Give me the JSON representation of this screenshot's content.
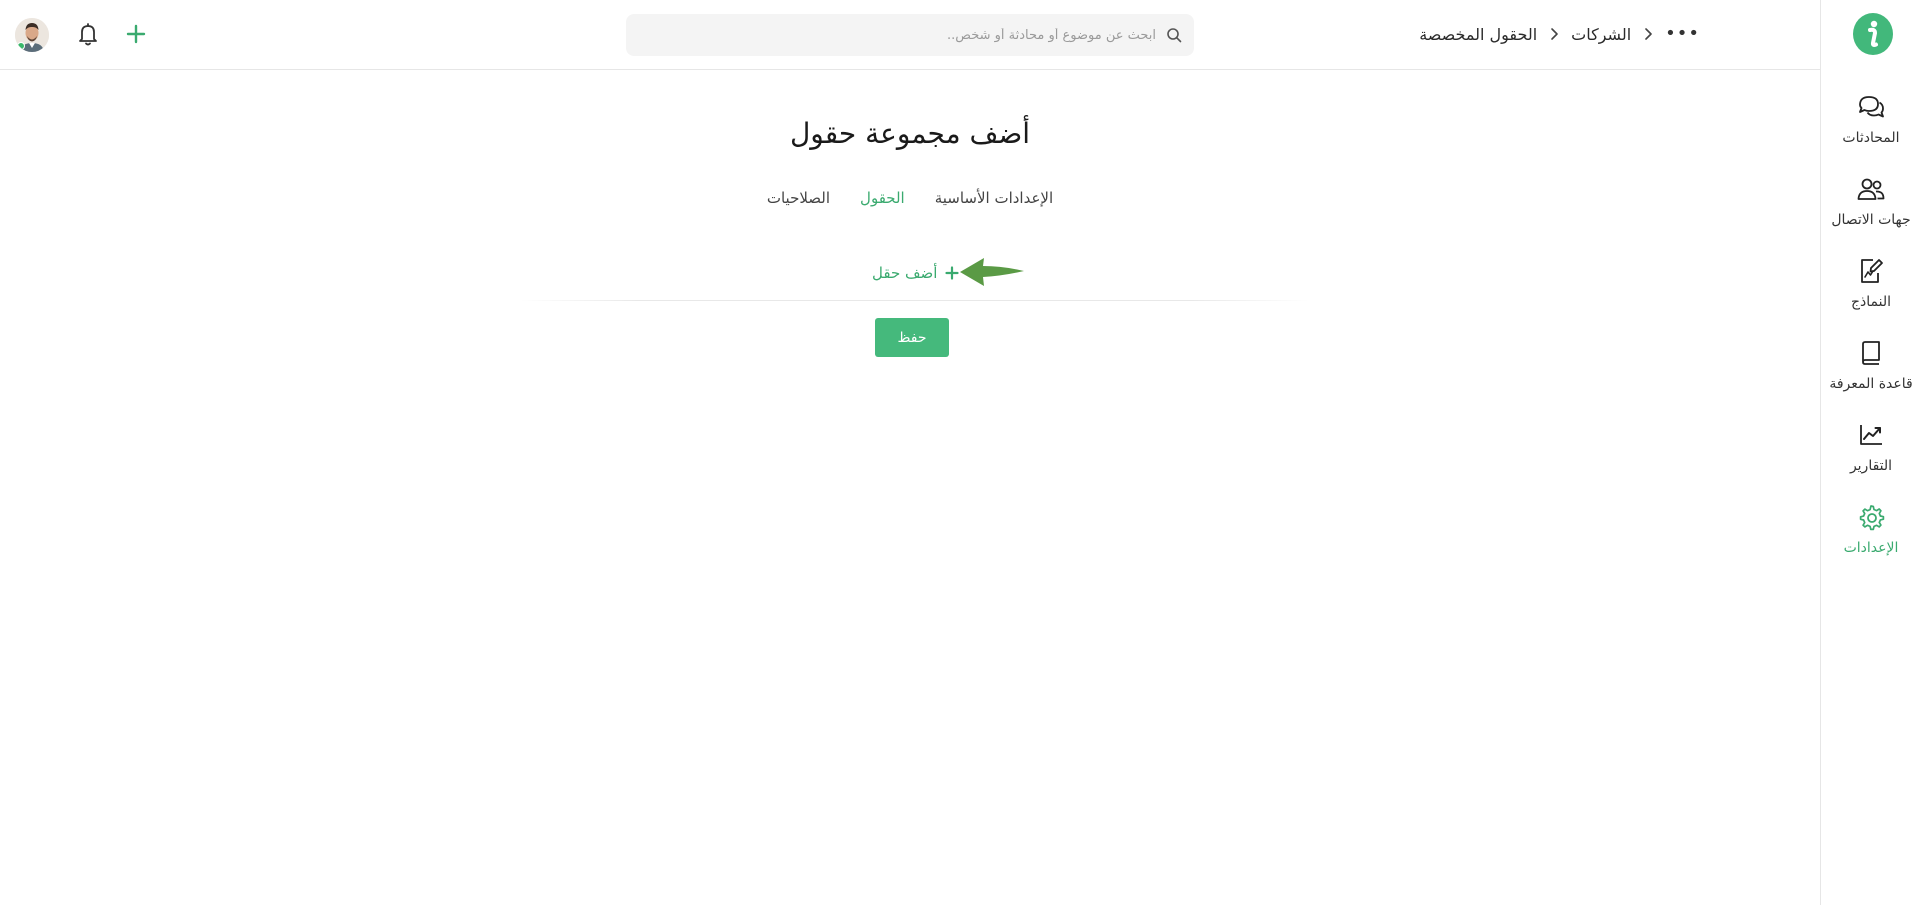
{
  "topbar": {
    "search": {
      "placeholder": "ابحث عن موضوع أو محادثة أو شخص..",
      "value": ""
    },
    "breadcrumb": [
      "الشركات",
      "الحقول المخصصة"
    ],
    "icons": [
      "avatar",
      "bell-icon",
      "plus-icon",
      "more-icon",
      "search-icon"
    ]
  },
  "sidebar": {
    "items": [
      {
        "label": "المحادثات",
        "icon": "chat-bubbles-icon",
        "active": false
      },
      {
        "label": "جهات الاتصال",
        "icon": "contacts-icon",
        "active": false
      },
      {
        "label": "النماذج",
        "icon": "form-edit-icon",
        "active": false
      },
      {
        "label": "قاعدة المعرفة",
        "icon": "book-icon",
        "active": false
      },
      {
        "label": "التقارير",
        "icon": "chart-trend-icon",
        "active": false
      },
      {
        "label": "الإعدادات",
        "icon": "gear-icon",
        "active": true
      }
    ]
  },
  "main": {
    "title": "أضف مجموعة حقول",
    "tabs": [
      {
        "label": "الإعدادات الأساسية",
        "active": false
      },
      {
        "label": "الحقول",
        "active": true
      },
      {
        "label": "الصلاحيات",
        "active": false
      }
    ],
    "add_field_label": "أضف حقل",
    "save_label": "حفظ"
  },
  "colors": {
    "accent": "#3aaa6f",
    "button": "#45b97c",
    "arrow": "#5a9a45"
  }
}
